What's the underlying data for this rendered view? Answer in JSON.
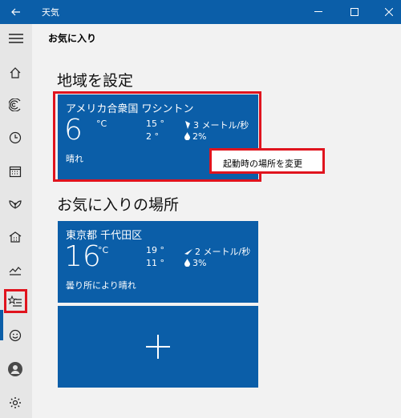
{
  "window": {
    "title": "天気"
  },
  "header": {
    "title": "お気に入り"
  },
  "home_section": {
    "title": "地域を設定",
    "card": {
      "location": "アメリカ合衆国 ワシントン",
      "temp": "6",
      "unit": "°C",
      "high": "15 °",
      "low": "2 °",
      "wind": "3 メートル/秒",
      "precip": "2%",
      "condition": "晴れ"
    }
  },
  "context_menu": {
    "item": "起動時の場所を変更"
  },
  "favorites_section": {
    "title": "お気に入りの場所",
    "cards": [
      {
        "location": "東京都 千代田区",
        "temp": "16",
        "unit": "°C",
        "high": "19 °",
        "low": "11 °",
        "wind": "2 メートル/秒",
        "precip": "3%",
        "condition": "曇り所により晴れ"
      }
    ],
    "add_icon": "plus-icon"
  },
  "sidebar": {
    "items": [
      {
        "icon": "hamburger-menu-icon"
      },
      {
        "icon": "home-icon"
      },
      {
        "icon": "forecast-icon"
      },
      {
        "icon": "history-clock-icon"
      },
      {
        "icon": "calendar-icon"
      },
      {
        "icon": "lotus-icon"
      },
      {
        "icon": "building-icon"
      },
      {
        "icon": "chart-icon"
      },
      {
        "icon": "favorites-star-list-icon",
        "active": true
      },
      {
        "icon": "smiley-icon"
      },
      {
        "icon": "account-icon"
      },
      {
        "icon": "settings-gear-icon"
      }
    ]
  },
  "colors": {
    "accent": "#0b5ea8",
    "highlight_red": "#e0141e",
    "sidebar_bg": "#e6e6e6",
    "page_bg": "#f2f2f2"
  }
}
